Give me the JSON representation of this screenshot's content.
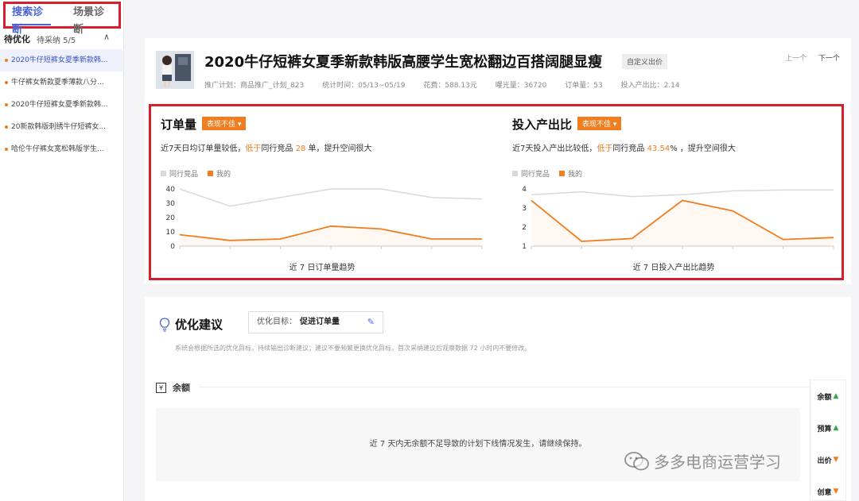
{
  "sidebar": {
    "tabs": [
      {
        "label": "搜索诊断"
      },
      {
        "label": "场景诊断"
      }
    ],
    "todo_title": "待优化",
    "todo_count": "待采纳 5/5",
    "tasks": [
      {
        "label": "2020牛仔短裤女夏季新款韩..."
      },
      {
        "label": "牛仔裤女新款夏季薄款八分..."
      },
      {
        "label": "2020牛仔短裤女夏季新款韩..."
      },
      {
        "label": "20新款韩版刺绣牛仔短裤女..."
      },
      {
        "label": "哈伦牛仔裤女宽松韩版学生..."
      }
    ]
  },
  "product": {
    "title": "2020牛仔短裤女夏季新款韩版高腰学生宽松翻边百搭阔腿显瘦",
    "custom_bid": "自定义出价",
    "prev": "上一个",
    "next": "下一个",
    "meta": [
      "推广计划：商品推广_计划_823",
      "统计时间：05/13~05/19",
      "花费：588.13元",
      "曝光量：36720",
      "订单量：53",
      "投入产出比：2.14"
    ]
  },
  "panels": {
    "orders": {
      "title": "订单量",
      "badge": "表现不佳",
      "desc_a": "近7天日均订单量较低，",
      "desc_b": "低于",
      "desc_c": "同行竞品 ",
      "desc_d": "28",
      "desc_e": " 单，提升空间很大",
      "legend_peer": "同行竞品",
      "legend_mine": "我的",
      "caption": "近 7 日订单量趋势"
    },
    "roi": {
      "title": "投入产出比",
      "badge": "表现不佳",
      "desc_a": "近7天投入产出比较低，",
      "desc_b": "低于",
      "desc_c": "同行竞品 ",
      "desc_d": "43.54",
      "desc_e": "% ，提升空间很大",
      "legend_peer": "同行竞品",
      "legend_mine": "我的",
      "caption": "近 7 日投入产出比趋势"
    }
  },
  "chart_data": [
    {
      "type": "line",
      "title": "近 7 日订单量趋势",
      "x": [
        1,
        2,
        3,
        4,
        5,
        6,
        7
      ],
      "yticks": [
        "0",
        "10",
        "20",
        "30",
        "40"
      ],
      "ylim": [
        0,
        40
      ],
      "series": [
        {
          "name": "同行竞品",
          "values": [
            40,
            28,
            34,
            40,
            40,
            34,
            33
          ],
          "color": "#d9d9d9"
        },
        {
          "name": "我的",
          "values": [
            8,
            4,
            5,
            14,
            12,
            5,
            5
          ],
          "color": "#f07d1e"
        }
      ]
    },
    {
      "type": "line",
      "title": "近 7 日投入产出比趋势",
      "x": [
        1,
        2,
        3,
        4,
        5,
        6,
        7
      ],
      "yticks": [
        "1",
        "2",
        "3",
        "4"
      ],
      "ylim": [
        1,
        4
      ],
      "series": [
        {
          "name": "同行竞品",
          "values": [
            3.7,
            3.85,
            3.6,
            3.7,
            3.9,
            3.95,
            3.95
          ],
          "color": "#d9d9d9"
        },
        {
          "name": "我的",
          "values": [
            3.4,
            1.25,
            1.4,
            3.4,
            2.85,
            1.35,
            1.45
          ],
          "color": "#f07d1e"
        }
      ]
    }
  ],
  "optimization": {
    "title": "优化建议",
    "goal_label": "优化目标：",
    "goal_value": "促进订单量",
    "desc": "系统会根据所选的优化目标，持续输出诊断建议；建议不要频繁更换优化目标，首次采纳建议后观察数据 72 小时内不要修改。",
    "balance_title": "余额",
    "balance_message": "近 7 天内无余额不足导致的计划下线情况发生，请继续保持。"
  },
  "rail": [
    {
      "label": "余额",
      "status": "good"
    },
    {
      "label": "预算",
      "status": "good"
    },
    {
      "label": "出价",
      "status": "bad"
    },
    {
      "label": "创意",
      "status": "bad"
    }
  ],
  "watermark": "多多电商运营学习",
  "colors": {
    "accent": "#4a63d8",
    "warn": "#f07d1e",
    "highlight_border": "#d81e2c"
  }
}
